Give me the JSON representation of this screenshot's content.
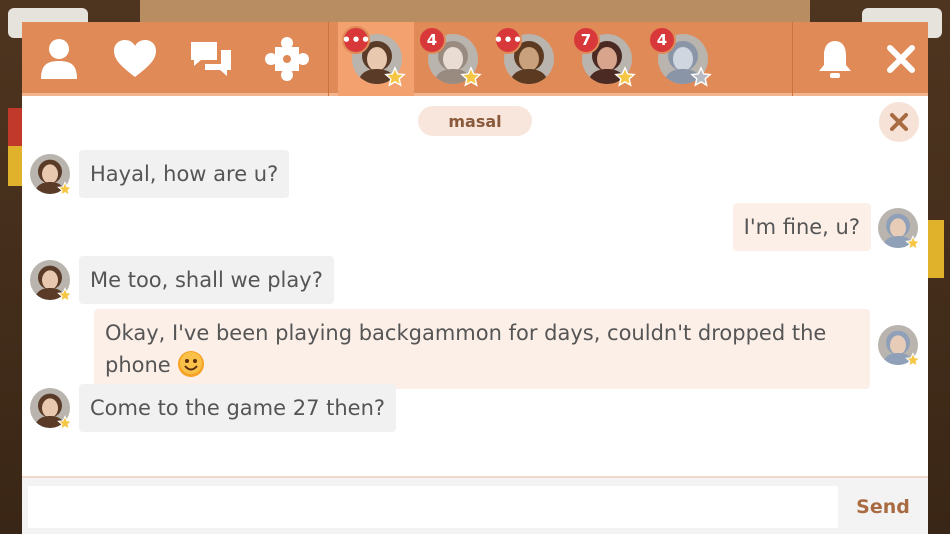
{
  "topbar": {
    "icons": [
      "profile-icon",
      "favorites-heart-icon",
      "chat-bubbles-icon",
      "puzzle-icon",
      "bell-icon",
      "close-icon"
    ],
    "contacts": [
      {
        "name": "contact-1",
        "badge": "•••",
        "star": "gold",
        "active": true,
        "skin": "#e8c9b0",
        "hair": "#5a3b28"
      },
      {
        "name": "contact-2",
        "badge": "4",
        "star": "gold",
        "active": false,
        "skin": "#e9dcd2",
        "hair": "#9a8b80"
      },
      {
        "name": "contact-3",
        "badge": "•••",
        "star": "none",
        "active": false,
        "skin": "#c9a27d",
        "hair": "#5c3a22"
      },
      {
        "name": "contact-4",
        "badge": "7",
        "star": "gold",
        "active": false,
        "skin": "#d8a58c",
        "hair": "#4a2a22"
      },
      {
        "name": "contact-5",
        "badge": "4",
        "star": "grey",
        "active": false,
        "skin": "#cfd6e0",
        "hair": "#8a96a8"
      }
    ]
  },
  "chat": {
    "title": "masal",
    "messages": [
      {
        "dir": "in",
        "text": "Hayal, how are u?"
      },
      {
        "dir": "out",
        "text": "I'm fine, u?"
      },
      {
        "dir": "in",
        "text": "Me too, shall we play?"
      },
      {
        "dir": "out",
        "text": "Okay, I've been playing backgammon for days, couldn't dropped the phone",
        "emoji": "smiley"
      },
      {
        "dir": "in",
        "text": "Come to the game 27 then?"
      }
    ]
  },
  "input": {
    "value": "",
    "placeholder": "",
    "send_label": "Send"
  },
  "colors": {
    "topbar": "#e08a57",
    "accent": "#a86b42",
    "badge": "#d8383a",
    "incoming_bubble": "#f1f1f1",
    "outgoing_bubble": "#fcefe8"
  }
}
